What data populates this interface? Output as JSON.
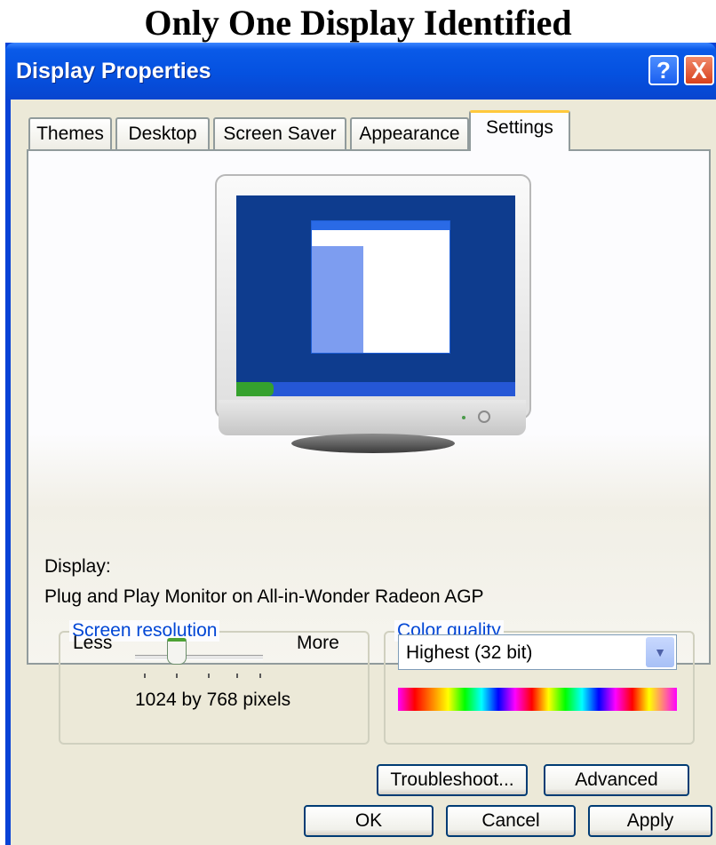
{
  "heading": "Only One Display Identified",
  "window": {
    "title": "Display Properties",
    "help_label": "?",
    "close_label": "X"
  },
  "tabs": [
    {
      "label": "Themes",
      "active": false
    },
    {
      "label": "Desktop",
      "active": false
    },
    {
      "label": "Screen Saver",
      "active": false
    },
    {
      "label": "Appearance",
      "active": false
    },
    {
      "label": "Settings",
      "active": true
    }
  ],
  "settings": {
    "display_label": "Display:",
    "display_value": "Plug and Play Monitor on All-in-Wonder Radeon AGP",
    "screen_resolution": {
      "title": "Screen resolution",
      "less": "Less",
      "more": "More",
      "value_text": "1024 by 768 pixels"
    },
    "color_quality": {
      "title": "Color quality",
      "selected": "Highest (32 bit)"
    }
  },
  "buttons": {
    "troubleshoot": "Troubleshoot...",
    "advanced": "Advanced",
    "ok": "OK",
    "cancel": "Cancel",
    "apply": "Apply"
  },
  "icons": [
    "help-icon",
    "close-icon",
    "monitor-icon",
    "chevron-down-icon"
  ],
  "colors": {
    "title_bar": "#0551e0",
    "window_face": "#ece9d8",
    "group_title": "#0046d5"
  }
}
